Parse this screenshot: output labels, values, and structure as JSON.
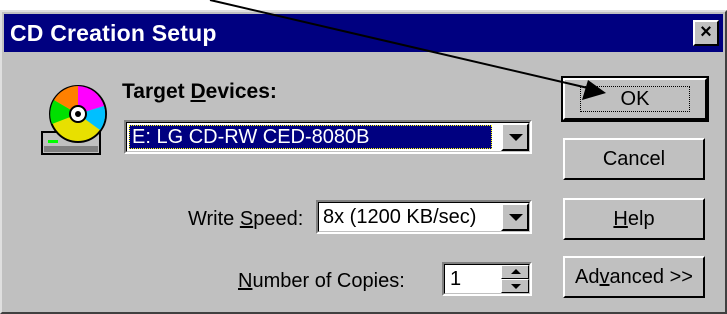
{
  "dialog": {
    "title": "CD Creation Setup",
    "close_label": "×",
    "icon": "cd-drive-icon"
  },
  "target_devices": {
    "label_prefix": "Target ",
    "label_accel": "D",
    "label_suffix": "evices:",
    "selected": "E: LG CD-RW CED-8080B"
  },
  "write_speed": {
    "label_prefix": "Write ",
    "label_accel": "S",
    "label_suffix": "peed:",
    "selected": "8x (1200 KB/sec)"
  },
  "copies": {
    "label_accel": "N",
    "label_suffix": "umber of Copies:",
    "value": "1"
  },
  "buttons": {
    "ok": "OK",
    "cancel": "Cancel",
    "help_accel": "H",
    "help_suffix": "elp",
    "advanced_prefix": "Ad",
    "advanced_accel": "v",
    "advanced_suffix": "anced >>"
  },
  "colors": {
    "titlebar": "#000080",
    "dialog_face": "#c0c0c0",
    "selection": "#000080"
  }
}
